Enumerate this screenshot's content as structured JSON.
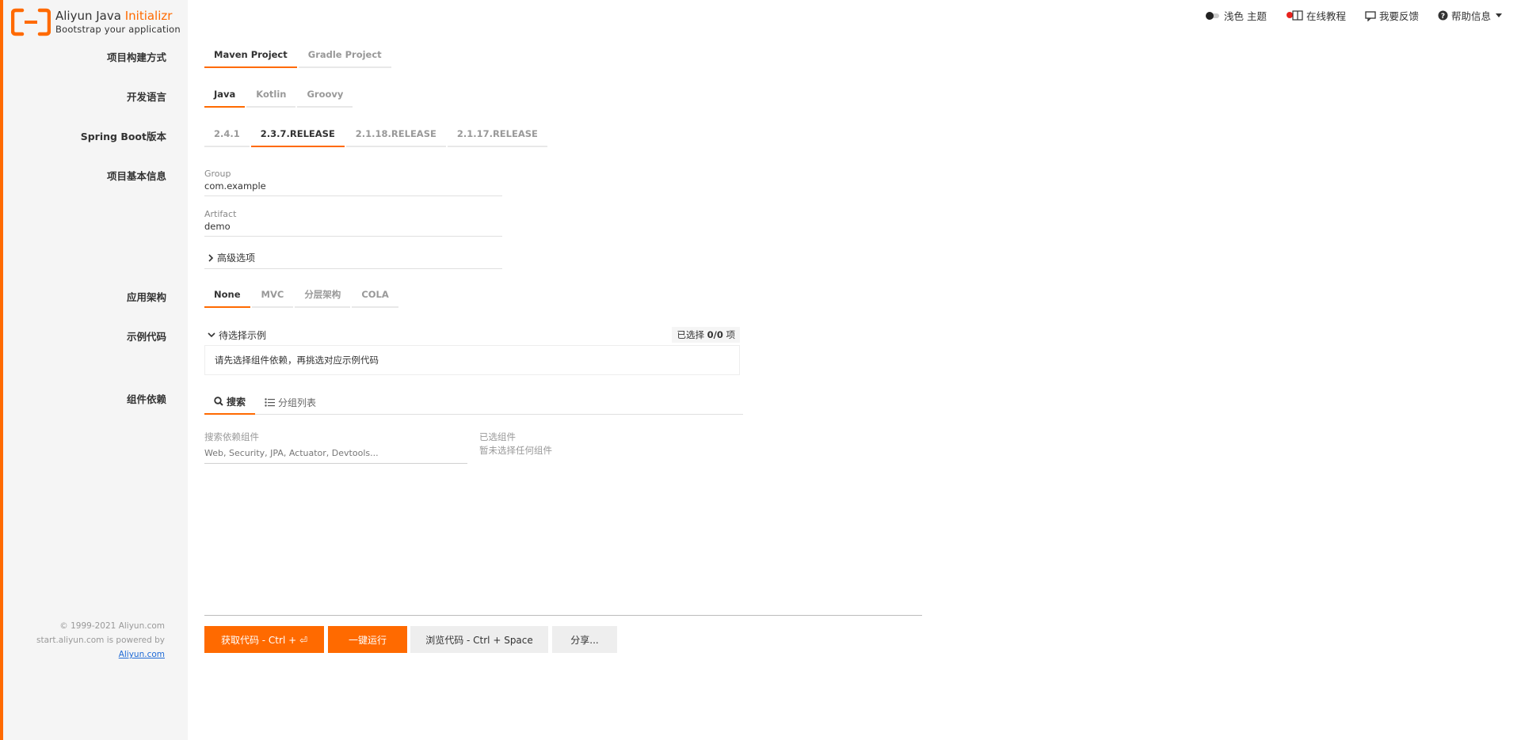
{
  "brand": {
    "name_prefix": "Aliyun Java ",
    "name_suffix": "Initializr",
    "tagline": "Bootstrap your application"
  },
  "footer": {
    "copyright": "© 1999-2021 Aliyun.com",
    "powered_by": "start.aliyun.com is powered by",
    "link_text": "Aliyun.com"
  },
  "topnav": {
    "theme": "浅色 主题",
    "tutorial": "在线教程",
    "feedback": "我要反馈",
    "help": "帮助信息"
  },
  "form": {
    "build": {
      "label": "项目构建方式",
      "options": [
        "Maven Project",
        "Gradle Project"
      ],
      "selected": "Maven Project"
    },
    "language": {
      "label": "开发语言",
      "options": [
        "Java",
        "Kotlin",
        "Groovy"
      ],
      "selected": "Java"
    },
    "boot_version": {
      "label": "Spring Boot版本",
      "options": [
        "2.4.1",
        "2.3.7.RELEASE",
        "2.1.18.RELEASE",
        "2.1.17.RELEASE"
      ],
      "selected": "2.3.7.RELEASE"
    },
    "metadata": {
      "label": "项目基本信息",
      "group_label": "Group",
      "group_value": "com.example",
      "artifact_label": "Artifact",
      "artifact_value": "demo",
      "advanced_label": "高级选项"
    },
    "architecture": {
      "label": "应用架构",
      "options": [
        "None",
        "MVC",
        "分层架构",
        "COLA"
      ],
      "selected": "None"
    },
    "examples": {
      "label": "示例代码",
      "header": "待选择示例",
      "count_prefix": "已选择 ",
      "count_value": "0/0",
      "count_suffix": " 项",
      "hint": "请先选择组件依赖，再挑选对应示例代码"
    },
    "dependencies": {
      "label": "组件依赖",
      "tab_search": "搜索",
      "tab_groups": "分组列表",
      "search_label": "搜索依赖组件",
      "search_placeholder": "Web, Security, JPA, Actuator, Devtools...",
      "selected_label": "已选组件",
      "selected_empty": "暂未选择任何组件"
    }
  },
  "actions": {
    "get_code": "获取代码 - Ctrl + ⏎",
    "run": "一键运行",
    "browse": "浏览代码 - Ctrl + Space",
    "share": "分享..."
  },
  "colors": {
    "accent": "#ff6a00",
    "sidebar_bg": "#f5f5f5",
    "link": "#1e6ad6"
  }
}
